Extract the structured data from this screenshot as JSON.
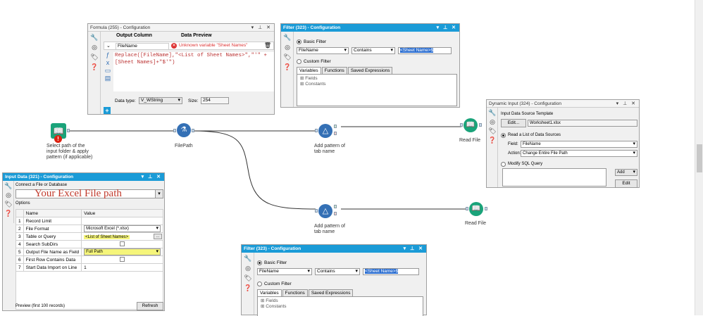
{
  "formula_panel": {
    "title": "Formula (255) - Configuration",
    "col_output": "Output Column",
    "col_preview": "Data Preview",
    "output_value": "FileName",
    "preview_value": "Unknown variable \"Sheet Names\"",
    "expr_line1": "Replace([FileName],\"<List of Sheet Names>\",\"'\" +",
    "expr_line2": "[Sheet Names]+\"$'\")",
    "datatype_label": "Data type:",
    "datatype_value": "V_WString",
    "size_label": "Size:",
    "size_value": "254",
    "add_label": "+"
  },
  "filter_top": {
    "title": "Filter (323) - Configuration",
    "basic_label": "Basic Filter",
    "field": "FileName",
    "op": "Contains",
    "value": "<Sheet Name>$",
    "custom_label": "Custom Filter",
    "tabs": [
      "Variables",
      "Functions",
      "Saved Expressions"
    ],
    "tree": [
      "Fields",
      "Constants"
    ]
  },
  "filter_bottom": {
    "title": "Filter (323) - Configuration",
    "basic_label": "Basic Filter",
    "field": "FileName",
    "op": "Contains",
    "value": "<Sheet Name>$",
    "custom_label": "Custom Filter",
    "tabs": [
      "Variables",
      "Functions",
      "Saved Expressions"
    ],
    "tree": [
      "Fields",
      "Constants"
    ]
  },
  "dynamic_input": {
    "title": "Dynamic Input (324) - Configuration",
    "template_label": "Input Data Source Template",
    "edit_label": "Edit...",
    "template_file": "Worksheet1.xlsx",
    "read_list_label": "Read a List of Data Sources",
    "field_label": "Field:",
    "field_value": "FileName",
    "action_label": "Action:",
    "action_value": "Change Entire File Path",
    "modify_sql_label": "Modify SQL Query",
    "add_label": "Add",
    "edit2_label": "Edit"
  },
  "input_data": {
    "title": "Input Data (321) - Configuration",
    "connect_label": "Connect a File or Database",
    "path_annotation": "Your Excel File path",
    "options_label": "Options",
    "col_name": "Name",
    "col_value": "Value",
    "rows": [
      {
        "n": "1",
        "name": "Record Limit",
        "value": ""
      },
      {
        "n": "2",
        "name": "File Format",
        "value": "Microsoft Excel (*.xlsx)"
      },
      {
        "n": "3",
        "name": "Table or Query",
        "value": "<List of Sheet Names>"
      },
      {
        "n": "4",
        "name": "Search SubDirs",
        "value": ""
      },
      {
        "n": "5",
        "name": "Output File Name as Field",
        "value": "Full Path"
      },
      {
        "n": "6",
        "name": "First Row Contains Data",
        "value": ""
      },
      {
        "n": "7",
        "name": "Start Data Import on Line",
        "value": "1"
      }
    ],
    "preview_label": "Preview (first 100 records)",
    "refresh_label": "Refresh"
  },
  "canvas": {
    "dir_caption": "Select path of the input folder & apply pattern (if applicable)",
    "filepath_caption": "FilePath",
    "filter1_caption": "Add pattern of tab name",
    "filter2_caption": "Add pattern of tab name",
    "read1_caption": "Read File",
    "read2_caption": "Read File"
  },
  "colors": {
    "title_blue": "#1a9bd7",
    "tool_green": "#1aa37a",
    "tool_blue": "#3470b5",
    "highlight": "#f5f57a"
  }
}
